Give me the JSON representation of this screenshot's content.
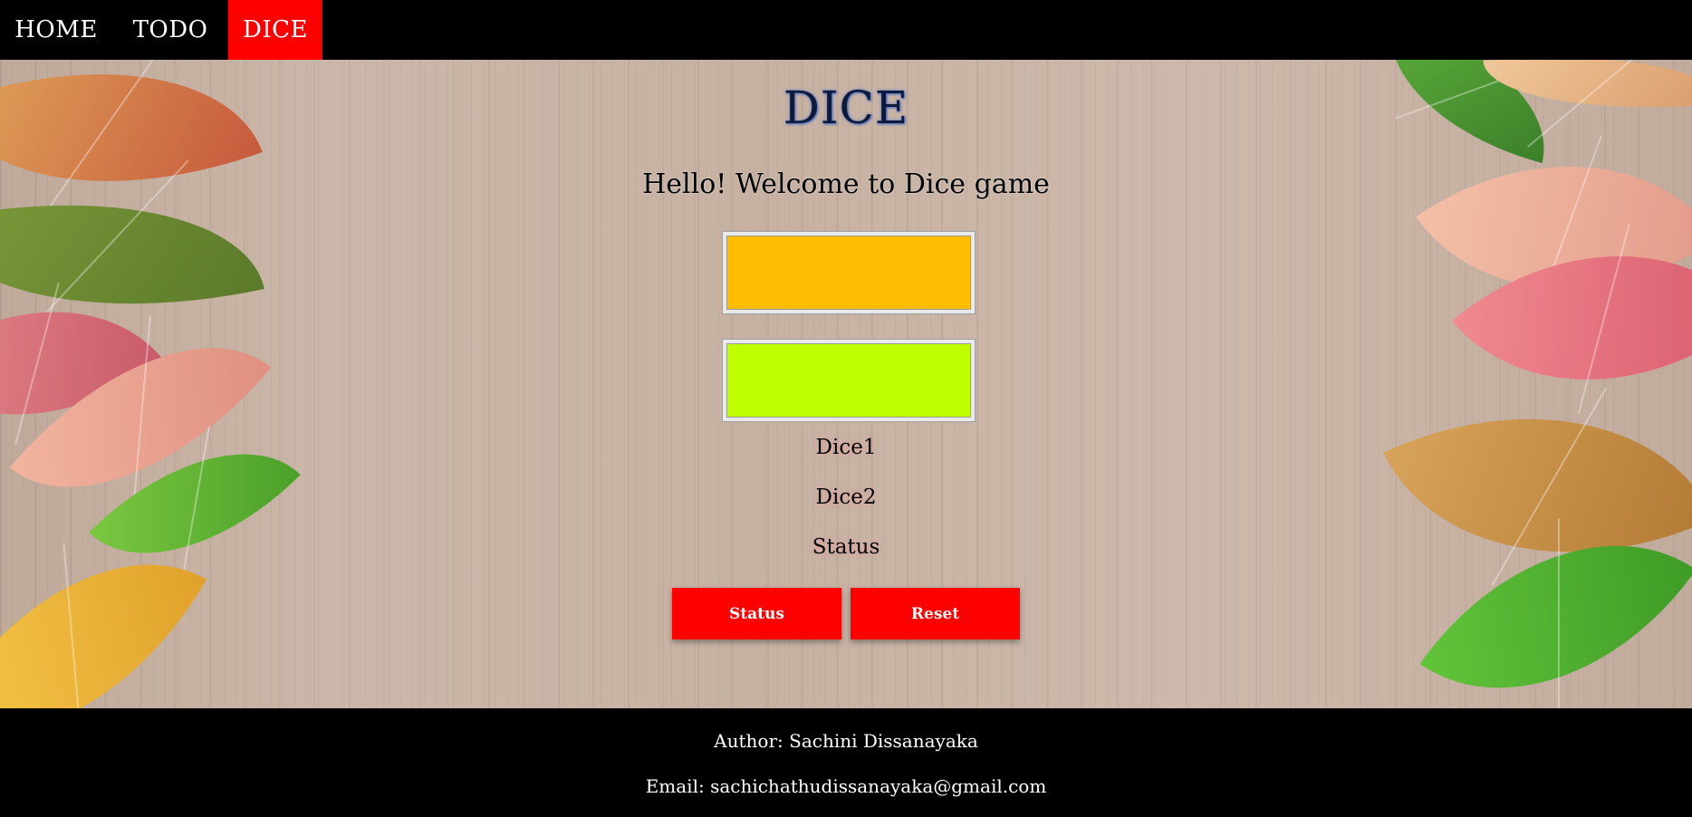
{
  "nav": {
    "items": [
      {
        "label": "HOME"
      },
      {
        "label": "TODO"
      },
      {
        "label": "DICE"
      }
    ],
    "active_color": "#ff0000"
  },
  "main": {
    "title": "DICE",
    "welcome": "Hello! Welcome to Dice game",
    "dice1_color": "#ffbd00",
    "dice2_color": "#bfff00",
    "dice1_label": "Dice1",
    "dice2_label": "Dice2",
    "status_label": "Status",
    "buttons": {
      "status": "Status",
      "reset": "Reset"
    }
  },
  "footer": {
    "author": "Author: Sachini Dissanayaka",
    "email": "Email: sachichathudissanayaka@gmail.com"
  }
}
